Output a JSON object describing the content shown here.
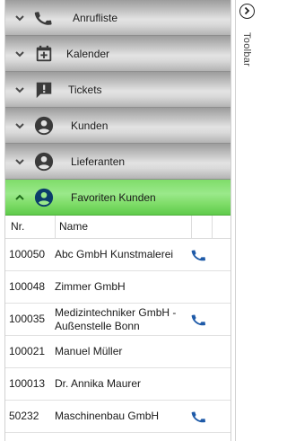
{
  "accordion": {
    "sections": [
      {
        "label": "Anrufliste",
        "icon": "phone-icon",
        "expanded": false
      },
      {
        "label": "Kalender",
        "icon": "calendar-icon",
        "expanded": false
      },
      {
        "label": "Tickets",
        "icon": "ticket-icon",
        "expanded": false
      },
      {
        "label": "Kunden",
        "icon": "person-icon",
        "expanded": false
      },
      {
        "label": "Lieferanten",
        "icon": "person-icon",
        "expanded": false
      },
      {
        "label": "Favoriten Kunden",
        "icon": "person-icon",
        "expanded": true
      }
    ]
  },
  "grid": {
    "columns": {
      "nr": "Nr.",
      "name": "Name"
    },
    "rows": [
      {
        "nr": "100050",
        "name": "Abc GmbH Kunstmalerei",
        "has_phone": true
      },
      {
        "nr": "100048",
        "name": "Zimmer GmbH",
        "has_phone": false
      },
      {
        "nr": "100035",
        "name": "Medizintechniker GmbH - Außenstelle Bonn",
        "has_phone": true
      },
      {
        "nr": "100021",
        "name": "Manuel Müller",
        "has_phone": false
      },
      {
        "nr": "100013",
        "name": "Dr. Annika Maurer",
        "has_phone": false
      },
      {
        "nr": "50232",
        "name": "Maschinenbau GmbH",
        "has_phone": true
      }
    ]
  },
  "toolbar": {
    "label": "Toolbar",
    "expand_icon": "chevron-right-circle-icon"
  },
  "colors": {
    "active_header": "#7fdc6a",
    "icon_dark": "#3a3a3a",
    "icon_active": "#0b3d6b",
    "phone_blue": "#1e5aa8"
  }
}
